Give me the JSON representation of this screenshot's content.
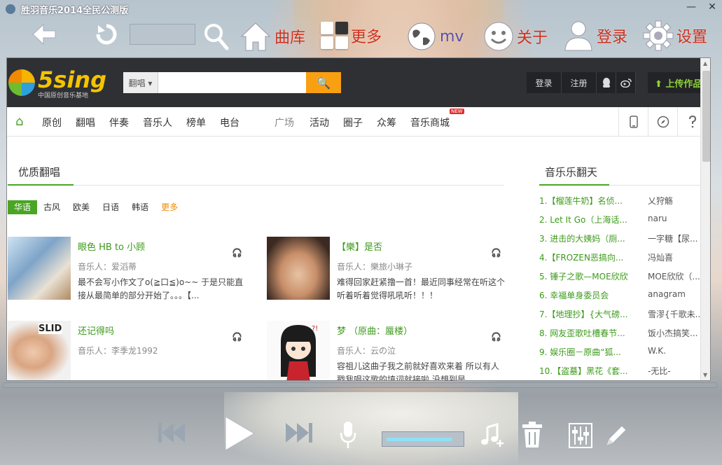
{
  "window": {
    "title": "胜羽音乐2014全民公测版",
    "min": "—",
    "close": "✕"
  },
  "toolbar": {
    "library_label": "曲库",
    "more_label": "更多",
    "mv_label": "mv",
    "about_label": "关于",
    "login_label": "登录",
    "settings_label": "设置",
    "search_value": ""
  },
  "site": {
    "logo_text": "5sing",
    "logo_sub": "中国原创音乐基地",
    "search_category": "翻唱 ▾",
    "search_value": "",
    "search_button": "🔍",
    "login": "登录",
    "register": "注册",
    "upload": "⬆ 上传作品",
    "nav": [
      "原创",
      "翻唱",
      "伴奏",
      "音乐人",
      "榜单",
      "电台",
      "广场",
      "活动",
      "圈子",
      "众筹",
      "音乐商城"
    ],
    "new_badge": "NEW",
    "section_left": "优质翻唱",
    "section_right": "音乐乐翻天",
    "tabs": [
      "华语",
      "古风",
      "欧美",
      "日语",
      "韩语",
      "更多"
    ],
    "cards": [
      {
        "title": "眼色  HB to 小顾",
        "artist": "音乐人：爱滔蒂",
        "desc": "最不会写小作文了o(≧口≦)o~~ 于是只能直接从最简单的部分开始了。。。【..."
      },
      {
        "title": "【樂】是否",
        "artist": "音乐人：樂旅小琳子",
        "desc": "难得回家赶紧撸一首！最近同事经常在听这个 听着听着觉得吼吼听！！！"
      },
      {
        "title": "还记得吗",
        "artist": "音乐人：李季龙1992",
        "desc": ""
      },
      {
        "title": "梦 （原曲：蜃楼）",
        "artist": "音乐人：云の泣",
        "desc": "容祖儿这曲子我之前就好喜欢来着  所以有人 戳我唱这歌的填词就接啦  没想到是"
      }
    ],
    "chart": [
      {
        "title": "1.【榴莲牛奶】名侦...",
        "artist": "乂狩觞"
      },
      {
        "title": "2. Let It Go（上海话...",
        "artist": "naru"
      },
      {
        "title": "3. 进击的大姨妈（厕...",
        "artist": "一字糖【尿..."
      },
      {
        "title": "4.【FROZEN恶搞向...",
        "artist": "冯灿喜"
      },
      {
        "title": "5. 锤子之歌—MOE欣欣",
        "artist": "MOE欣欣（..."
      },
      {
        "title": "6. 幸福单身委员会",
        "artist": "anagram"
      },
      {
        "title": "7.【地理抄】{大气磅...",
        "artist": "雪漻{千歌未..."
      },
      {
        "title": "8. 网友歪歌吐槽春节...",
        "artist": "饭小杰搞笑..."
      },
      {
        "title": "9. 娱乐圈－原曲“狐...",
        "artist": "W.K."
      },
      {
        "title": "10.【盗墓】黑花《套...",
        "artist": "-无比-"
      }
    ]
  },
  "player": {
    "volume": 0.9
  }
}
